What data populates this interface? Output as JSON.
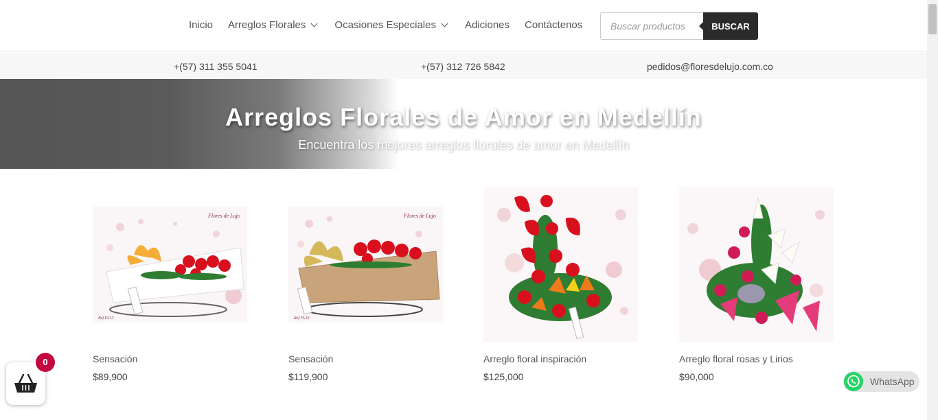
{
  "nav": {
    "items": [
      {
        "label": "Inicio",
        "dropdown": false
      },
      {
        "label": "Arreglos Florales",
        "dropdown": true
      },
      {
        "label": "Ocasiones Especiales",
        "dropdown": true
      },
      {
        "label": "Adiciones",
        "dropdown": false
      },
      {
        "label": "Contáctenos",
        "dropdown": false
      }
    ],
    "search_placeholder": "Buscar productos",
    "search_button": "BUSCAR"
  },
  "contact": {
    "phone1": "+(57) 311 355 5041",
    "phone2": "+(57) 312 726 5842",
    "email": "pedidos@floresdelujo.com.co"
  },
  "hero": {
    "title": "Arreglos Florales de Amor en Medellín",
    "subtitle": "Encuentra los mejores arreglos florales de amor en Medellín"
  },
  "products": [
    {
      "name": "Sensación",
      "price": "$89,900",
      "brand": "Flores de Lujo",
      "ref": "Ref FL13",
      "box": "white"
    },
    {
      "name": "Sensación",
      "price": "$119,900",
      "brand": "Flores de Lujo",
      "ref": "Ref FL16",
      "box": "kraft"
    },
    {
      "name": "Arreglo floral inspiración",
      "price": "$125,000",
      "brand": "",
      "ref": "",
      "box": "tall"
    },
    {
      "name": "Arreglo floral rosas y Lirios",
      "price": "$90,000",
      "brand": "",
      "ref": "",
      "box": "lilies"
    }
  ],
  "cart": {
    "count": "0",
    "icon": "basket-icon"
  },
  "whatsapp": {
    "label": "WhatsApp",
    "icon": "whatsapp-icon",
    "color": "#25d366"
  },
  "colors": {
    "dark_button": "#2b2b2b",
    "badge": "#c3073f",
    "rose": "#d8101e"
  }
}
